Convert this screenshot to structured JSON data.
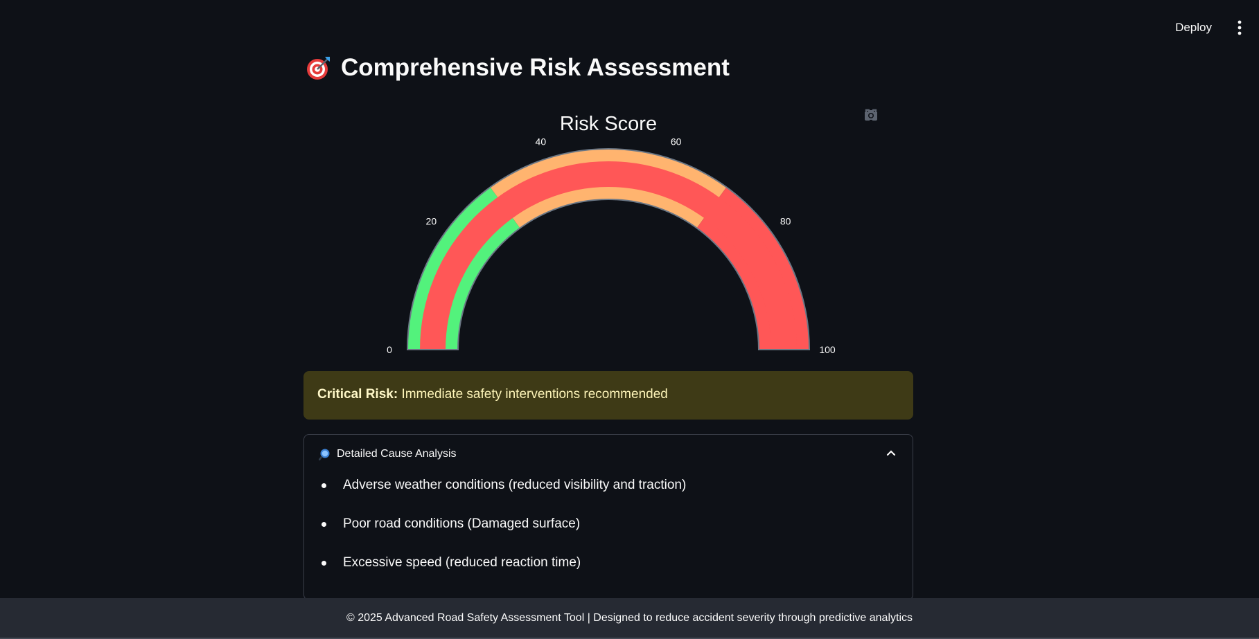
{
  "header": {
    "deploy_label": "Deploy",
    "menu_icon": "kebab-menu-icon"
  },
  "page": {
    "title": "Comprehensive Risk Assessment",
    "title_icon": "target-dart-icon"
  },
  "chart_data": {
    "type": "gauge",
    "title": "Risk Score",
    "value": 100,
    "range": [
      0,
      100
    ],
    "tick_labels": [
      "0",
      "20",
      "40",
      "60",
      "80",
      "100"
    ],
    "steps": [
      {
        "range": [
          0,
          30
        ],
        "color": "#53f27c"
      },
      {
        "range": [
          30,
          70
        ],
        "color": "#ffb46f"
      },
      {
        "range": [
          70,
          100
        ],
        "color": "#ff5757"
      }
    ],
    "bar_color": "#ff5757",
    "modebar": [
      "camera-icon",
      "fullscreen-icon"
    ]
  },
  "alert": {
    "label": "Critical Risk:",
    "message": "Immediate safety interventions recommended",
    "background": "#3e3a16"
  },
  "cause_analysis": {
    "title": "Detailed Cause Analysis",
    "icon": "magnifier-icon",
    "expanded": true,
    "items": [
      "Adverse weather conditions (reduced visibility and traction)",
      "Poor road conditions (Damaged surface)",
      "Excessive speed (reduced reaction time)"
    ]
  },
  "footer": {
    "text": "© 2025 Advanced Road Safety Assessment Tool | Designed to reduce accident severity through predictive analytics"
  }
}
